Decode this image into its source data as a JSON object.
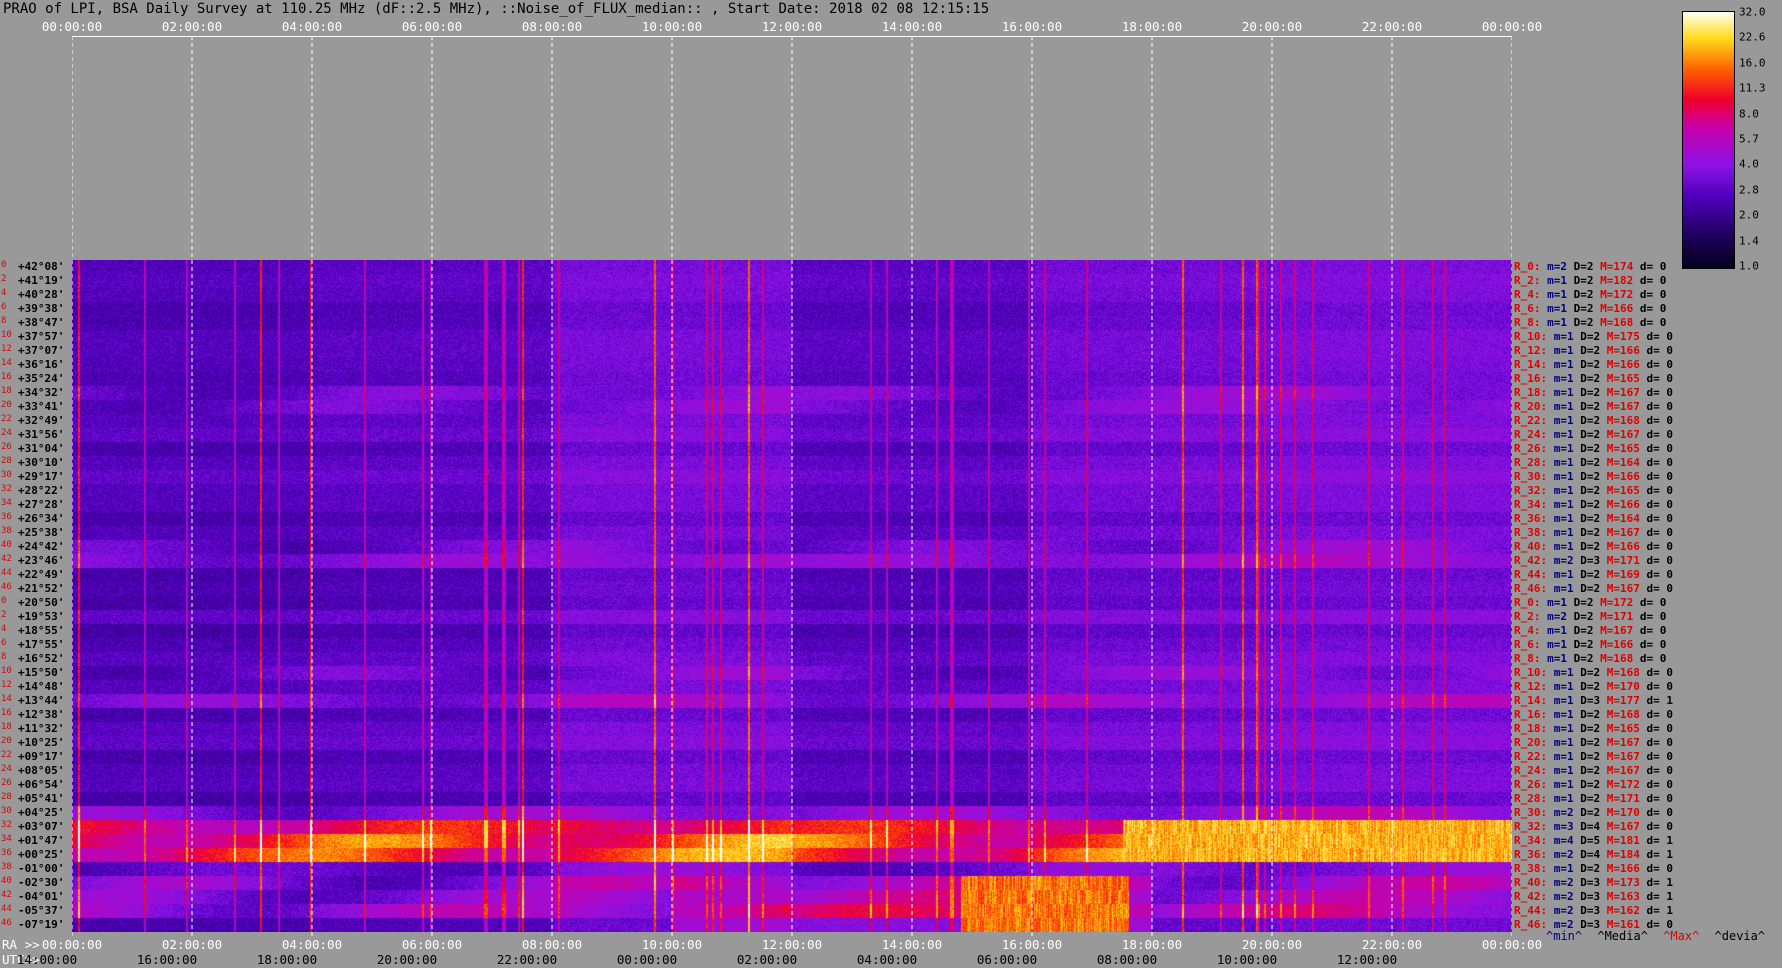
{
  "title": "PRAO of LPI, BSA Daily Survey at 110.25 MHz (dF::2.5 MHz), ::Noise_of_FLUX_median:: , Start Date: 2018 02 08 12:15:15",
  "top_time_labels": [
    "00:00:00",
    "02:00:00",
    "04:00:00",
    "06:00:00",
    "08:00:00",
    "10:00:00",
    "12:00:00",
    "14:00:00",
    "16:00:00",
    "18:00:00",
    "20:00:00",
    "22:00:00",
    "00:00:00"
  ],
  "ra_label": "RA >>",
  "utc_label": "UTC>>",
  "ra_time_labels": [
    "00:00:00",
    "02:00:00",
    "04:00:00",
    "06:00:00",
    "08:00:00",
    "10:00:00",
    "12:00:00",
    "14:00:00",
    "16:00:00",
    "18:00:00",
    "20:00:00",
    "22:00:00",
    "00:00:00"
  ],
  "utc_time_labels": [
    "14:00:00",
    "16:00:00",
    "18:00:00",
    "20:00:00",
    "22:00:00",
    "00:00:00",
    "02:00:00",
    "04:00:00",
    "06:00:00",
    "08:00:00",
    "10:00:00",
    "12:00:00"
  ],
  "declinations": [
    {
      "idx": "0",
      "dec": "+42°08'"
    },
    {
      "idx": "2",
      "dec": "+41°19'"
    },
    {
      "idx": "4",
      "dec": "+40°28'"
    },
    {
      "idx": "6",
      "dec": "+39°38'"
    },
    {
      "idx": "8",
      "dec": "+38°47'"
    },
    {
      "idx": "10",
      "dec": "+37°57'"
    },
    {
      "idx": "12",
      "dec": "+37°07'"
    },
    {
      "idx": "14",
      "dec": "+36°16'"
    },
    {
      "idx": "16",
      "dec": "+35°24'"
    },
    {
      "idx": "18",
      "dec": "+34°32'"
    },
    {
      "idx": "20",
      "dec": "+33°41'"
    },
    {
      "idx": "22",
      "dec": "+32°49'"
    },
    {
      "idx": "24",
      "dec": "+31°56'"
    },
    {
      "idx": "26",
      "dec": "+31°04'"
    },
    {
      "idx": "28",
      "dec": "+30°10'"
    },
    {
      "idx": "30",
      "dec": "+29°17'"
    },
    {
      "idx": "32",
      "dec": "+28°22'"
    },
    {
      "idx": "34",
      "dec": "+27°28'"
    },
    {
      "idx": "36",
      "dec": "+26°34'"
    },
    {
      "idx": "38",
      "dec": "+25°38'"
    },
    {
      "idx": "40",
      "dec": "+24°42'"
    },
    {
      "idx": "42",
      "dec": "+23°46'"
    },
    {
      "idx": "44",
      "dec": "+22°49'"
    },
    {
      "idx": "46",
      "dec": "+21°52'"
    },
    {
      "idx": "0",
      "dec": "+20°50'"
    },
    {
      "idx": "2",
      "dec": "+19°53'"
    },
    {
      "idx": "4",
      "dec": "+18°55'"
    },
    {
      "idx": "6",
      "dec": "+17°55'"
    },
    {
      "idx": "8",
      "dec": "+16°52'"
    },
    {
      "idx": "10",
      "dec": "+15°50'"
    },
    {
      "idx": "12",
      "dec": "+14°48'"
    },
    {
      "idx": "14",
      "dec": "+13°44'"
    },
    {
      "idx": "16",
      "dec": "+12°38'"
    },
    {
      "idx": "18",
      "dec": "+11°32'"
    },
    {
      "idx": "20",
      "dec": "+10°25'"
    },
    {
      "idx": "22",
      "dec": "+09°17'"
    },
    {
      "idx": "24",
      "dec": "+08°05'"
    },
    {
      "idx": "26",
      "dec": "+06°54'"
    },
    {
      "idx": "28",
      "dec": "+05°41'"
    },
    {
      "idx": "30",
      "dec": "+04°25'"
    },
    {
      "idx": "32",
      "dec": "+03°07'"
    },
    {
      "idx": "34",
      "dec": "+01°47'"
    },
    {
      "idx": "36",
      "dec": "+00°25'"
    },
    {
      "idx": "38",
      "dec": "-01°00'"
    },
    {
      "idx": "40",
      "dec": "-02°30'"
    },
    {
      "idx": "42",
      "dec": "-04°01'"
    },
    {
      "idx": "44",
      "dec": "-05°37'"
    },
    {
      "idx": "46",
      "dec": "-07°19'"
    }
  ],
  "stats": [
    {
      "r": "R_0:",
      "m": "m=2",
      "d": "D=2",
      "M": "M=174",
      "dev": "d= 0"
    },
    {
      "r": "R_2:",
      "m": "m=1",
      "d": "D=2",
      "M": "M=182",
      "dev": "d= 0"
    },
    {
      "r": "R_4:",
      "m": "m=1",
      "d": "D=2",
      "M": "M=172",
      "dev": "d= 0"
    },
    {
      "r": "R_6:",
      "m": "m=1",
      "d": "D=2",
      "M": "M=166",
      "dev": "d= 0"
    },
    {
      "r": "R_8:",
      "m": "m=1",
      "d": "D=2",
      "M": "M=168",
      "dev": "d= 0"
    },
    {
      "r": "R_10:",
      "m": "m=1",
      "d": "D=2",
      "M": "M=175",
      "dev": "d= 0"
    },
    {
      "r": "R_12:",
      "m": "m=1",
      "d": "D=2",
      "M": "M=166",
      "dev": "d= 0"
    },
    {
      "r": "R_14:",
      "m": "m=1",
      "d": "D=2",
      "M": "M=166",
      "dev": "d= 0"
    },
    {
      "r": "R_16:",
      "m": "m=1",
      "d": "D=2",
      "M": "M=165",
      "dev": "d= 0"
    },
    {
      "r": "R_18:",
      "m": "m=1",
      "d": "D=2",
      "M": "M=167",
      "dev": "d= 0"
    },
    {
      "r": "R_20:",
      "m": "m=1",
      "d": "D=2",
      "M": "M=167",
      "dev": "d= 0"
    },
    {
      "r": "R_22:",
      "m": "m=1",
      "d": "D=2",
      "M": "M=168",
      "dev": "d= 0"
    },
    {
      "r": "R_24:",
      "m": "m=1",
      "d": "D=2",
      "M": "M=167",
      "dev": "d= 0"
    },
    {
      "r": "R_26:",
      "m": "m=1",
      "d": "D=2",
      "M": "M=165",
      "dev": "d= 0"
    },
    {
      "r": "R_28:",
      "m": "m=1",
      "d": "D=2",
      "M": "M=164",
      "dev": "d= 0"
    },
    {
      "r": "R_30:",
      "m": "m=1",
      "d": "D=2",
      "M": "M=166",
      "dev": "d= 0"
    },
    {
      "r": "R_32:",
      "m": "m=1",
      "d": "D=2",
      "M": "M=165",
      "dev": "d= 0"
    },
    {
      "r": "R_34:",
      "m": "m=1",
      "d": "D=2",
      "M": "M=166",
      "dev": "d= 0"
    },
    {
      "r": "R_36:",
      "m": "m=1",
      "d": "D=2",
      "M": "M=164",
      "dev": "d= 0"
    },
    {
      "r": "R_38:",
      "m": "m=1",
      "d": "D=2",
      "M": "M=167",
      "dev": "d= 0"
    },
    {
      "r": "R_40:",
      "m": "m=1",
      "d": "D=2",
      "M": "M=166",
      "dev": "d= 0"
    },
    {
      "r": "R_42:",
      "m": "m=2",
      "d": "D=3",
      "M": "M=171",
      "dev": "d= 0"
    },
    {
      "r": "R_44:",
      "m": "m=1",
      "d": "D=2",
      "M": "M=169",
      "dev": "d= 0"
    },
    {
      "r": "R_46:",
      "m": "m=1",
      "d": "D=2",
      "M": "M=167",
      "dev": "d= 0"
    },
    {
      "r": "R_0:",
      "m": "m=1",
      "d": "D=2",
      "M": "M=172",
      "dev": "d= 0"
    },
    {
      "r": "R_2:",
      "m": "m=2",
      "d": "D=2",
      "M": "M=171",
      "dev": "d= 0"
    },
    {
      "r": "R_4:",
      "m": "m=1",
      "d": "D=2",
      "M": "M=167",
      "dev": "d= 0"
    },
    {
      "r": "R_6:",
      "m": "m=1",
      "d": "D=2",
      "M": "M=166",
      "dev": "d= 0"
    },
    {
      "r": "R_8:",
      "m": "m=1",
      "d": "D=2",
      "M": "M=168",
      "dev": "d= 0"
    },
    {
      "r": "R_10:",
      "m": "m=1",
      "d": "D=2",
      "M": "M=168",
      "dev": "d= 0"
    },
    {
      "r": "R_12:",
      "m": "m=1",
      "d": "D=2",
      "M": "M=170",
      "dev": "d= 0"
    },
    {
      "r": "R_14:",
      "m": "m=1",
      "d": "D=3",
      "M": "M=177",
      "dev": "d= 1"
    },
    {
      "r": "R_16:",
      "m": "m=1",
      "d": "D=2",
      "M": "M=168",
      "dev": "d= 0"
    },
    {
      "r": "R_18:",
      "m": "m=1",
      "d": "D=2",
      "M": "M=165",
      "dev": "d= 0"
    },
    {
      "r": "R_20:",
      "m": "m=1",
      "d": "D=2",
      "M": "M=167",
      "dev": "d= 0"
    },
    {
      "r": "R_22:",
      "m": "m=1",
      "d": "D=2",
      "M": "M=167",
      "dev": "d= 0"
    },
    {
      "r": "R_24:",
      "m": "m=1",
      "d": "D=2",
      "M": "M=167",
      "dev": "d= 0"
    },
    {
      "r": "R_26:",
      "m": "m=1",
      "d": "D=2",
      "M": "M=172",
      "dev": "d= 0"
    },
    {
      "r": "R_28:",
      "m": "m=1",
      "d": "D=2",
      "M": "M=171",
      "dev": "d= 0"
    },
    {
      "r": "R_30:",
      "m": "m=2",
      "d": "D=2",
      "M": "M=170",
      "dev": "d= 0"
    },
    {
      "r": "R_32:",
      "m": "m=3",
      "d": "D=4",
      "M": "M=167",
      "dev": "d= 0"
    },
    {
      "r": "R_34:",
      "m": "m=4",
      "d": "D=5",
      "M": "M=181",
      "dev": "d= 1"
    },
    {
      "r": "R_36:",
      "m": "m=2",
      "d": "D=4",
      "M": "M=184",
      "dev": "d= 1"
    },
    {
      "r": "R_38:",
      "m": "m=1",
      "d": "D=2",
      "M": "M=166",
      "dev": "d= 0"
    },
    {
      "r": "R_40:",
      "m": "m=2",
      "d": "D=3",
      "M": "M=173",
      "dev": "d= 1"
    },
    {
      "r": "R_42:",
      "m": "m=2",
      "d": "D=3",
      "M": "M=163",
      "dev": "d= 1"
    },
    {
      "r": "R_44:",
      "m": "m=2",
      "d": "D=3",
      "M": "M=162",
      "dev": "d= 1"
    },
    {
      "r": "R_46:",
      "m": "m=2",
      "d": "D=3",
      "M": "M=161",
      "dev": "d= 0"
    }
  ],
  "legend_bottom": {
    "min": "^min^",
    "media": "^Media^",
    "max": "^Max^",
    "devia": "^devia^"
  },
  "colorbar_ticks": [
    "32.0",
    "22.6",
    "16.0",
    "11.3",
    "8.0",
    "5.7",
    "4.0",
    "2.8",
    "2.0",
    "1.4",
    "1.0"
  ],
  "colors": {
    "background": "#999999",
    "stat_red": "#e00000",
    "stat_blue": "#000080"
  }
}
